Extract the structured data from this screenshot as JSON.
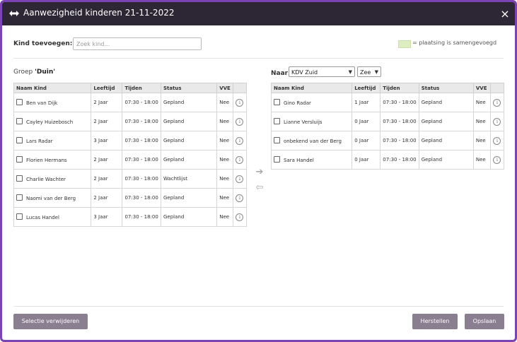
{
  "dialog": {
    "title": "Aanwezigheid kinderen 21-11-2022",
    "close_label": "×"
  },
  "add_child": {
    "label": "Kind toevoegen:",
    "placeholder": "Zoek kind...",
    "value": ""
  },
  "legend": {
    "text": "= plaatsing is samengevoegd",
    "color": "#dcedc1"
  },
  "left_group": {
    "prefix": "Groep",
    "name": "'Duin'",
    "columns": [
      "Naam Kind",
      "Leeftijd",
      "Tijden",
      "Status",
      "VVE"
    ],
    "rows": [
      {
        "name": "Ben van Dijk",
        "age": "2 Jaar",
        "times": "07:30 - 18:00",
        "status": "Gepland",
        "vve": "Nee"
      },
      {
        "name": "Cayley Huizebosch",
        "age": "2 Jaar",
        "times": "07:30 - 18:00",
        "status": "Gepland",
        "vve": "Nee"
      },
      {
        "name": "Lars Radar",
        "age": "3 Jaar",
        "times": "07:30 - 18:00",
        "status": "Gepland",
        "vve": "Nee"
      },
      {
        "name": "Florien Hermans",
        "age": "2 Jaar",
        "times": "07:30 - 18:00",
        "status": "Gepland",
        "vve": "Nee"
      },
      {
        "name": "Charlie Wachter",
        "age": "2 Jaar",
        "times": "07:30 - 18:00",
        "status": "Wachtlijst",
        "vve": "Nee"
      },
      {
        "name": "Naomi van der Berg",
        "age": "2 Jaar",
        "times": "07:30 - 18:00",
        "status": "Gepland",
        "vve": "Nee"
      },
      {
        "name": "Lucas Handel",
        "age": "3 Jaar",
        "times": "07:30 - 18:00",
        "status": "Gepland",
        "vve": "Nee"
      }
    ]
  },
  "right_group": {
    "label": "Naar:",
    "location": "KDV Zuid",
    "group": "Zee",
    "columns": [
      "Naam Kind",
      "Leeftijd",
      "Tijden",
      "Status",
      "VVE"
    ],
    "rows": [
      {
        "name": "Gino Radar",
        "age": "1 Jaar",
        "times": "07:30 - 18:00",
        "status": "Gepland",
        "vve": "Nee"
      },
      {
        "name": "Lianne Versluijs",
        "age": "0 Jaar",
        "times": "07:30 - 18:00",
        "status": "Gepland",
        "vve": "Nee"
      },
      {
        "name": "onbekend van der Berg",
        "age": "0 Jaar",
        "times": "07:30 - 18:00",
        "status": "Gepland",
        "vve": "Nee"
      },
      {
        "name": "Sara Handel",
        "age": "0 Jaar",
        "times": "07:30 - 18:00",
        "status": "Gepland",
        "vve": "Nee"
      }
    ]
  },
  "move_buttons": {
    "right": "➔",
    "left": "⇦"
  },
  "footer": {
    "remove_selection": "Selectie verwijderen",
    "restore": "Herstellen",
    "save": "Opslaan"
  },
  "colors": {
    "titlebar": "#2d2735",
    "border": "#7b43b3",
    "button": "#8a7e91"
  },
  "icons": {
    "title": "swap-arrows-icon",
    "info": "info-icon",
    "move_right": "arrow-right-icon",
    "move_left": "arrow-left-icon"
  }
}
